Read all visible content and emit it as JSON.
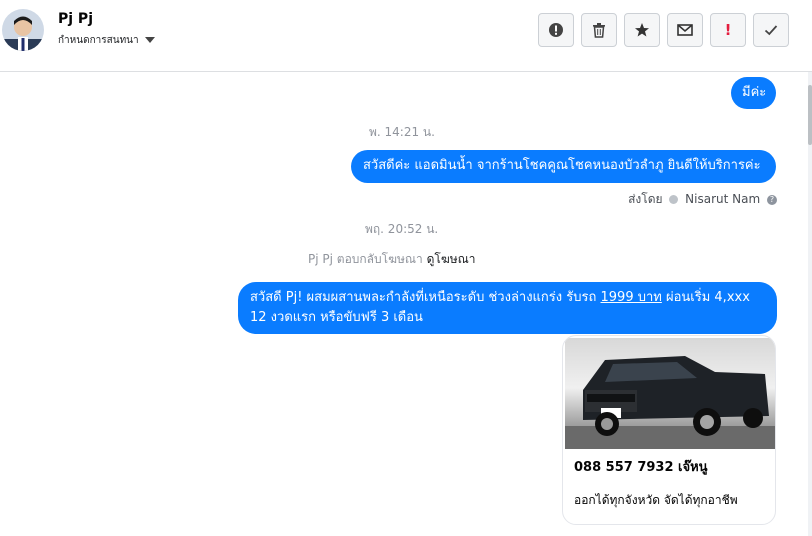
{
  "header": {
    "name": "Pj Pj",
    "subtitle": "กำหนดการสนทนา"
  },
  "toolbar": {
    "buttons": [
      {
        "icon": "alert-circle-icon"
      },
      {
        "icon": "trash-icon"
      },
      {
        "icon": "star-icon"
      },
      {
        "icon": "envelope-icon"
      },
      {
        "icon": "exclamation-icon",
        "label": "!"
      },
      {
        "icon": "checkmark-icon"
      }
    ]
  },
  "messages": {
    "m1": "มีค่ะ",
    "ts1": "พ. 14:21 น.",
    "m2": "สวัสดีค่ะ แอดมินน้ำ จากร้านโชคคูณโชคหนองบัวลำภู ยินดีให้บริการค่ะ",
    "sent_by_prefix": "ส่งโดย",
    "sent_by_name": "Nisarut Nam",
    "ts2": "พฤ. 20:52 น.",
    "ad_reply_prefix": "Pj Pj ตอบกลับโฆษณา",
    "ad_link": "ดูโฆษณา",
    "m3_part1": "สวัสดี Pj! ผสมผสานพละกำลังที่เหนือระดับ ช่วงล่างแกร่ง รับรถ ",
    "m3_link": "1999 บาท",
    "m3_part2": " ผ่อนเริ่ม 4,xxx",
    "m3_line2": "12 งวดแรก หรือขับฟรี 3 เดือน"
  },
  "card": {
    "line1": "088 557 7932 เจ๊หนู",
    "line2": "ออกได้ทุกจังหวัด จัดได้ทุกอาชีพ"
  },
  "colors": {
    "accent": "#0a7cff",
    "border": "#ccd0d5",
    "muted": "#90949c"
  }
}
